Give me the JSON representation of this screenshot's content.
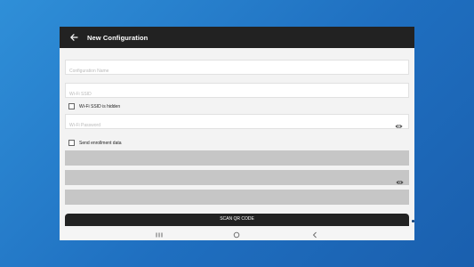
{
  "app": {
    "title": "New Configuration"
  },
  "form": {
    "config_name_placeholder": "Configuration Name",
    "wifi_ssid_placeholder": "Wi-Fi SSID",
    "ssid_hidden_label": "Wi-Fi SSID is hidden",
    "ssid_hidden_checked": false,
    "wifi_password_placeholder": "Wi-Fi Password",
    "send_enrollment_label": "Send enrollment data",
    "send_enrollment_checked": false,
    "scan_button_label": "SCAN QR CODE"
  },
  "icons": {
    "back": "arrow-back-icon",
    "eye": "eye-icon",
    "recents": "recents-icon",
    "home": "home-icon",
    "nav_back": "nav-back-icon"
  },
  "colors": {
    "app_bar": "#222222",
    "background": "#1f6fc0",
    "disabled_field": "#c6c6c6"
  }
}
